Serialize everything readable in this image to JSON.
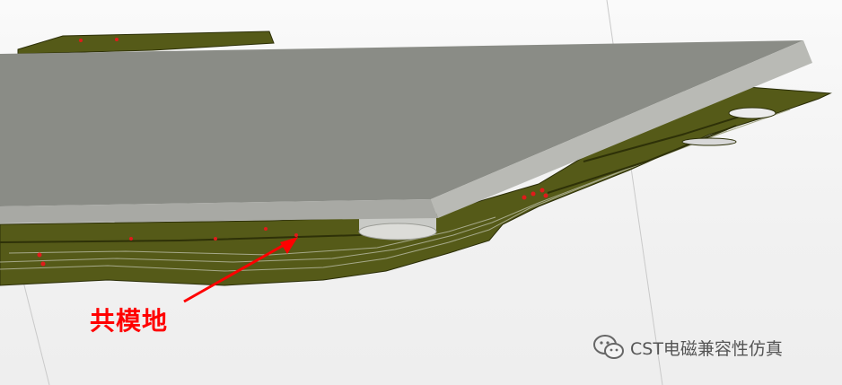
{
  "annotation": {
    "label": "共模地",
    "arrow_color": "#ff0000"
  },
  "watermark": {
    "icon": "wechat-icon",
    "text": "CST电磁兼容性仿真"
  },
  "colors": {
    "background": "#f4f4f4",
    "plate_top": "#8a8c86",
    "plate_edge": "#b9bab5",
    "pcb": "#555a18",
    "pcb_dark": "#3c3f0f",
    "via": "#e01b1b"
  }
}
